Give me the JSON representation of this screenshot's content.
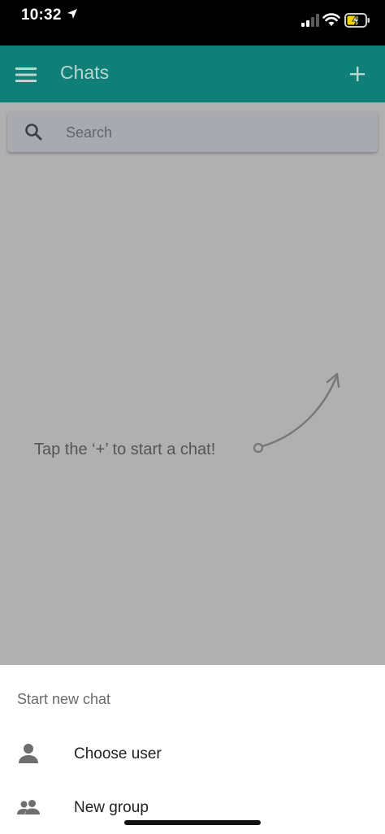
{
  "status_bar": {
    "time": "10:32",
    "location_icon": "location-arrow-icon",
    "signal_icon": "cellular-signal-icon",
    "wifi_icon": "wifi-icon",
    "battery_icon": "battery-charging-icon"
  },
  "header": {
    "title": "Chats",
    "menu_icon": "hamburger-menu-icon",
    "add_icon": "plus-icon",
    "background": "#0f7f77"
  },
  "search": {
    "placeholder": "Search",
    "value": "",
    "icon": "search-icon"
  },
  "empty_state": {
    "hint": "Tap the ‘+’ to start a chat!",
    "arrow_icon": "curved-arrow-icon"
  },
  "sheet": {
    "title": "Start new chat",
    "items": [
      {
        "label": "Choose user",
        "icon": "person-icon"
      },
      {
        "label": "New group",
        "icon": "group-icon"
      }
    ]
  },
  "colors": {
    "accent": "#0f7f77",
    "overlay": "#b0b0b0",
    "battery_fill": "#f2d200"
  }
}
